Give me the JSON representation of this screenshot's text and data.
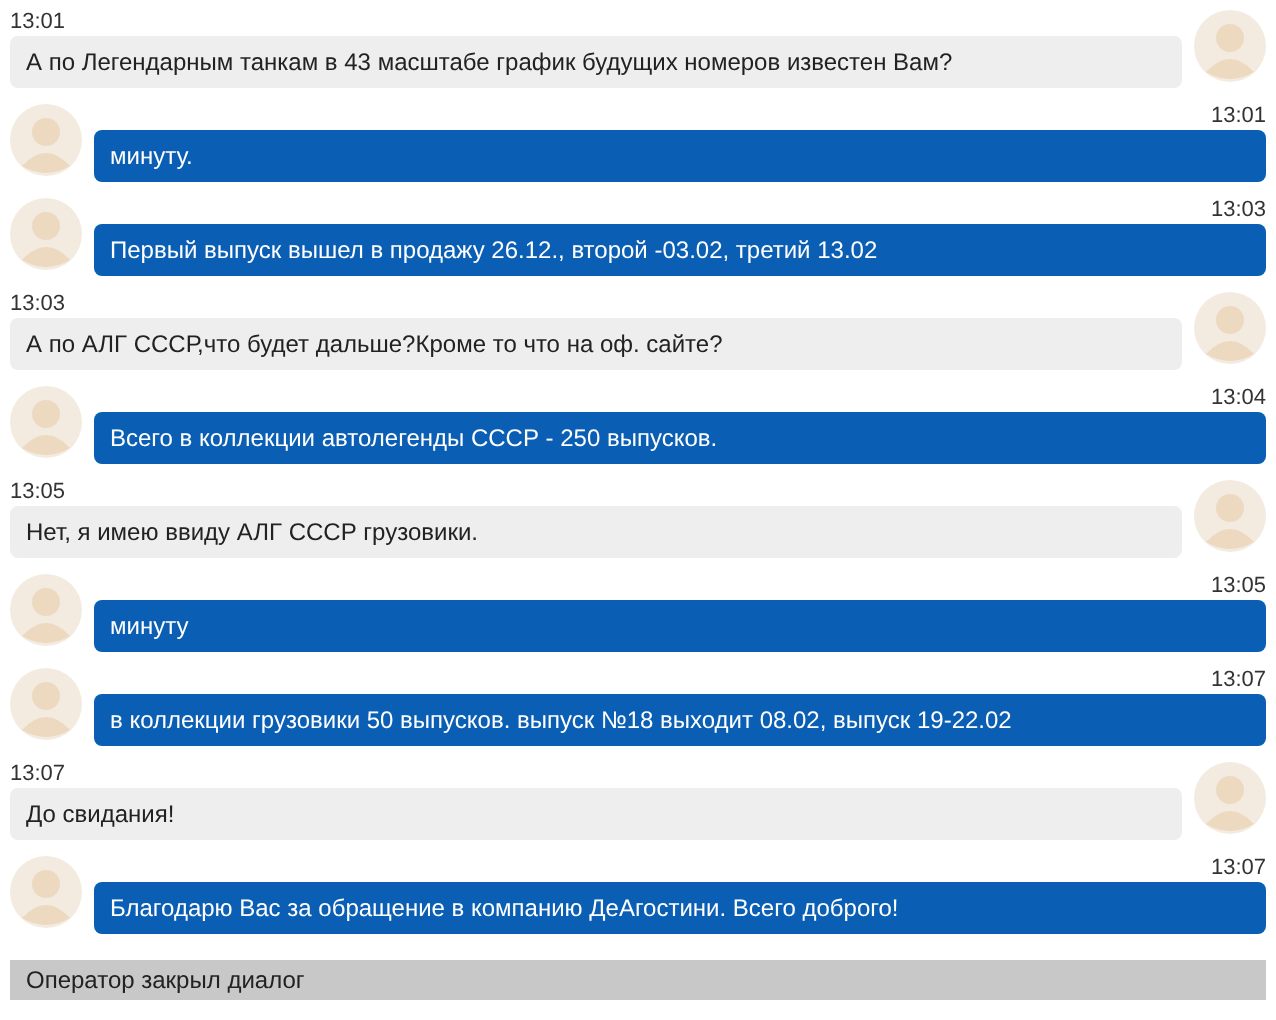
{
  "messages": [
    {
      "kind": "customer",
      "time": "13:01",
      "text": "А по Легендарным танкам в 43 масштабе график будущих номеров известен Вам?"
    },
    {
      "kind": "operator",
      "time": "13:01",
      "text": "минуту."
    },
    {
      "kind": "operator",
      "time": "13:03",
      "text": "Первый выпуск вышел в продажу 26.12., второй -03.02, третий 13.02"
    },
    {
      "kind": "customer",
      "time": "13:03",
      "text": "А по АЛГ СССР,что будет дальше?Кроме то что на оф. сайте?"
    },
    {
      "kind": "operator",
      "time": "13:04",
      "text": "Всего в коллекции автолегенды СССР - 250 выпусков."
    },
    {
      "kind": "customer",
      "time": "13:05",
      "text": "Нет, я имею ввиду АЛГ СССР грузовики."
    },
    {
      "kind": "operator",
      "time": "13:05",
      "text": "минуту"
    },
    {
      "kind": "operator",
      "time": "13:07",
      "text": "в коллекции грузовики 50 выпусков. выпуск №18 выходит 08.02, выпуск 19-22.02"
    },
    {
      "kind": "customer",
      "time": "13:07",
      "text": "До свидания!"
    },
    {
      "kind": "operator",
      "time": "13:07",
      "text": "Благодарю Вас за обращение в компанию ДеАгостини. Всего доброго!"
    }
  ],
  "status": "Оператор закрыл диалог"
}
